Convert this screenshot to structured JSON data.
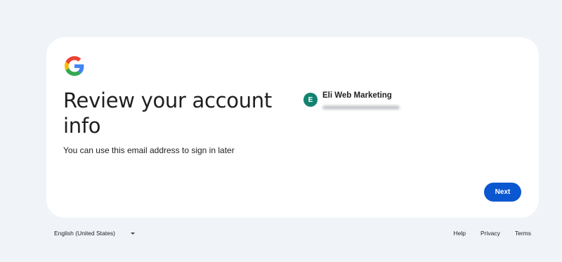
{
  "logo": {
    "icon": "google-g-icon"
  },
  "heading": "Review your account info",
  "subtitle": "You can use this email address to sign in later",
  "account": {
    "avatar_letter": "E",
    "avatar_color": "#11836f",
    "name": "Eli Web Marketing"
  },
  "next_button": {
    "label": "Next",
    "color": "#0b57d0"
  },
  "footer": {
    "language": "English (United States)",
    "links": [
      "Help",
      "Privacy",
      "Terms"
    ]
  }
}
